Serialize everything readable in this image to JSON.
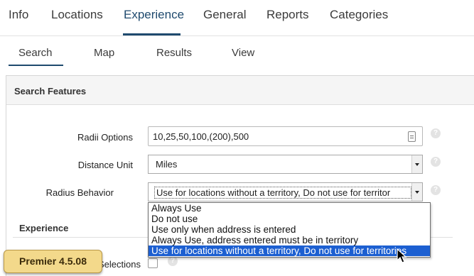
{
  "top_nav": {
    "tabs": [
      "Info",
      "Locations",
      "Experience",
      "General",
      "Reports",
      "Categories"
    ],
    "active": "Experience"
  },
  "sub_nav": {
    "tabs": [
      "Search",
      "Map",
      "Results",
      "View"
    ],
    "active": "Search"
  },
  "panel": {
    "title": "Search Features"
  },
  "fields": {
    "radii_label": "Radii Options",
    "radii_value": "10,25,50,100,(200),500",
    "unit_label": "Distance Unit",
    "unit_value": "Miles",
    "radius_label": "Radius Behavior",
    "radius_value": "Use for locations without a territory, Do not use for territor"
  },
  "dropdown": {
    "options": [
      "Always Use",
      "Do not use",
      "Use only when address is entered",
      "Always Use, address entered must be in territory",
      "Use for locations without a territory, Do not use for territories"
    ],
    "selected_index": 4
  },
  "experience_section": {
    "title": "Experience",
    "checkbox_label_partial": "Selections"
  },
  "badge": {
    "text": "Premier 4.5.08"
  },
  "icons": {
    "help": "question-mark-icon",
    "list": "list-icon",
    "cursor": "mouse-pointer-icon"
  },
  "colors": {
    "accent": "#1f4a6e",
    "selection": "#1c5fd1",
    "badge": "#f3d98b"
  }
}
